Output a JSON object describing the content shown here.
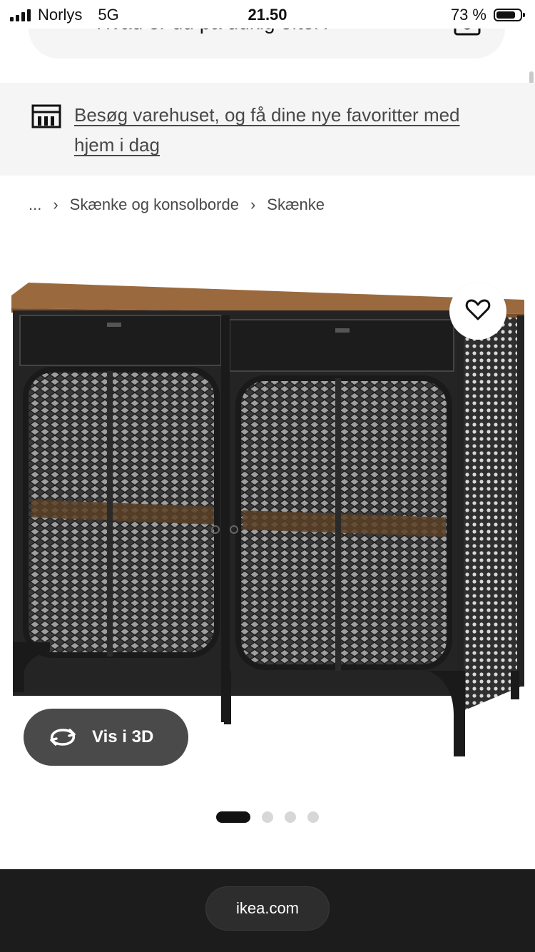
{
  "status_bar": {
    "carrier": "Norlys",
    "network": "5G",
    "time": "21.50",
    "battery": "73 %"
  },
  "search": {
    "placeholder": "Hvad er du på udkig efter?"
  },
  "banner": {
    "text": "Besøg varehuset, og få dine nye favoritter med hjem i dag",
    "icon": "store-icon"
  },
  "breadcrumb": {
    "items": [
      "...",
      "Skænke og konsolborde",
      "Skænke"
    ],
    "separator": "›"
  },
  "product": {
    "image_alt": "sideboard-image",
    "favorite_icon": "heart-icon"
  },
  "view3d": {
    "label": "Vis i 3D",
    "icon": "rotate-3d-icon"
  },
  "carousel": {
    "count": 4,
    "active": 0
  },
  "browser": {
    "url": "ikea.com"
  },
  "colors": {
    "bg": "#ffffff",
    "banner_bg": "#f5f5f5",
    "pill_bg": "#4a4a4a",
    "bottom_bar": "#1c1c1c",
    "wood": "#9a6a3e"
  }
}
